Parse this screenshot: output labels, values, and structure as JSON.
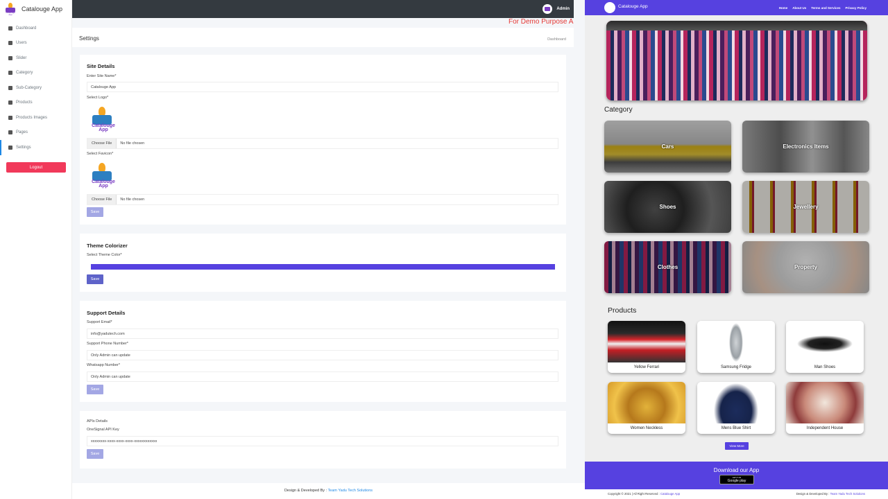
{
  "admin_app": {
    "brand": "Catalouge App",
    "logo_text": "Catalouge App",
    "nav": [
      {
        "label": "Dashboard",
        "icon": "home-icon"
      },
      {
        "label": "Users",
        "icon": "user-icon"
      },
      {
        "label": "Slider",
        "icon": "image-icon"
      },
      {
        "label": "Category",
        "icon": "list-icon"
      },
      {
        "label": "Sub-Category",
        "icon": "list-icon"
      },
      {
        "label": "Products",
        "icon": "box-icon"
      },
      {
        "label": "Products Images",
        "icon": "camera-icon"
      },
      {
        "label": "Pages",
        "icon": "file-icon"
      },
      {
        "label": "Settings",
        "icon": "gear-icon",
        "active": true
      }
    ],
    "logout_label": "Logout",
    "topbar": {
      "user": "Admin"
    },
    "demo_banner": "For Demo Purpose A",
    "page": {
      "title": "Settings",
      "breadcrumb": "Dashboard"
    },
    "site_details": {
      "title": "Site Details",
      "site_name_label": "Enter Site Name*",
      "site_name_value": "Catalouge App",
      "logo_label": "Select Logo*",
      "favicon_label": "Select Favicon*",
      "choose_file": "Choose File",
      "no_file": "No file chosen",
      "save": "Save"
    },
    "theme": {
      "title": "Theme Colorizer",
      "color_label": "Select Theme Color*",
      "color_value": "#5641e0",
      "save": "Save"
    },
    "support": {
      "title": "Support Details",
      "email_label": "Support Email*",
      "email_value": "info@yadutech.com",
      "phone_label": "Support Phone Number*",
      "phone_value": "Only Admin can update",
      "whatsapp_label": "Whatsapp Number*",
      "whatsapp_value": "Only Admin can update",
      "save": "Save"
    },
    "apis": {
      "title": "APIs Details",
      "onesignal_label": "OneSignal API Key",
      "onesignal_value": "xxxxxxxx-xxxx-xxxx-xxxx-xxxxxxxxxxxx",
      "save": "Save"
    },
    "footer": {
      "text": "Design & Developed By :",
      "link": "Team Yadu Tech Solutions"
    }
  },
  "store": {
    "brand": "Catalouge App",
    "nav_links": [
      "Home",
      "About Us",
      "Terms and Services",
      "Privacy Policy"
    ],
    "category_title": "Category",
    "categories": [
      "Cars",
      "Electronics Items",
      "Shoes",
      "Jewellery",
      "Clothes",
      "Property"
    ],
    "products_title": "Products",
    "products": [
      "Yellow Ferrari",
      "Samsung Fridge",
      "Man Shoes",
      "Women Neckless",
      "Mens Blue Shirt",
      "Independent House"
    ],
    "view_more": "View More",
    "download_title": "Download our App",
    "gplay_small": "GET IT ON",
    "gplay_big": "Google play",
    "copyright": "Copyright © 2021 | All Right Reserved :",
    "copyright_link": "Catalouge App",
    "dev_text": "Design & Developed By :",
    "dev_link": "Team Yadu Tech Solutions",
    "accent": "#5641e0"
  }
}
